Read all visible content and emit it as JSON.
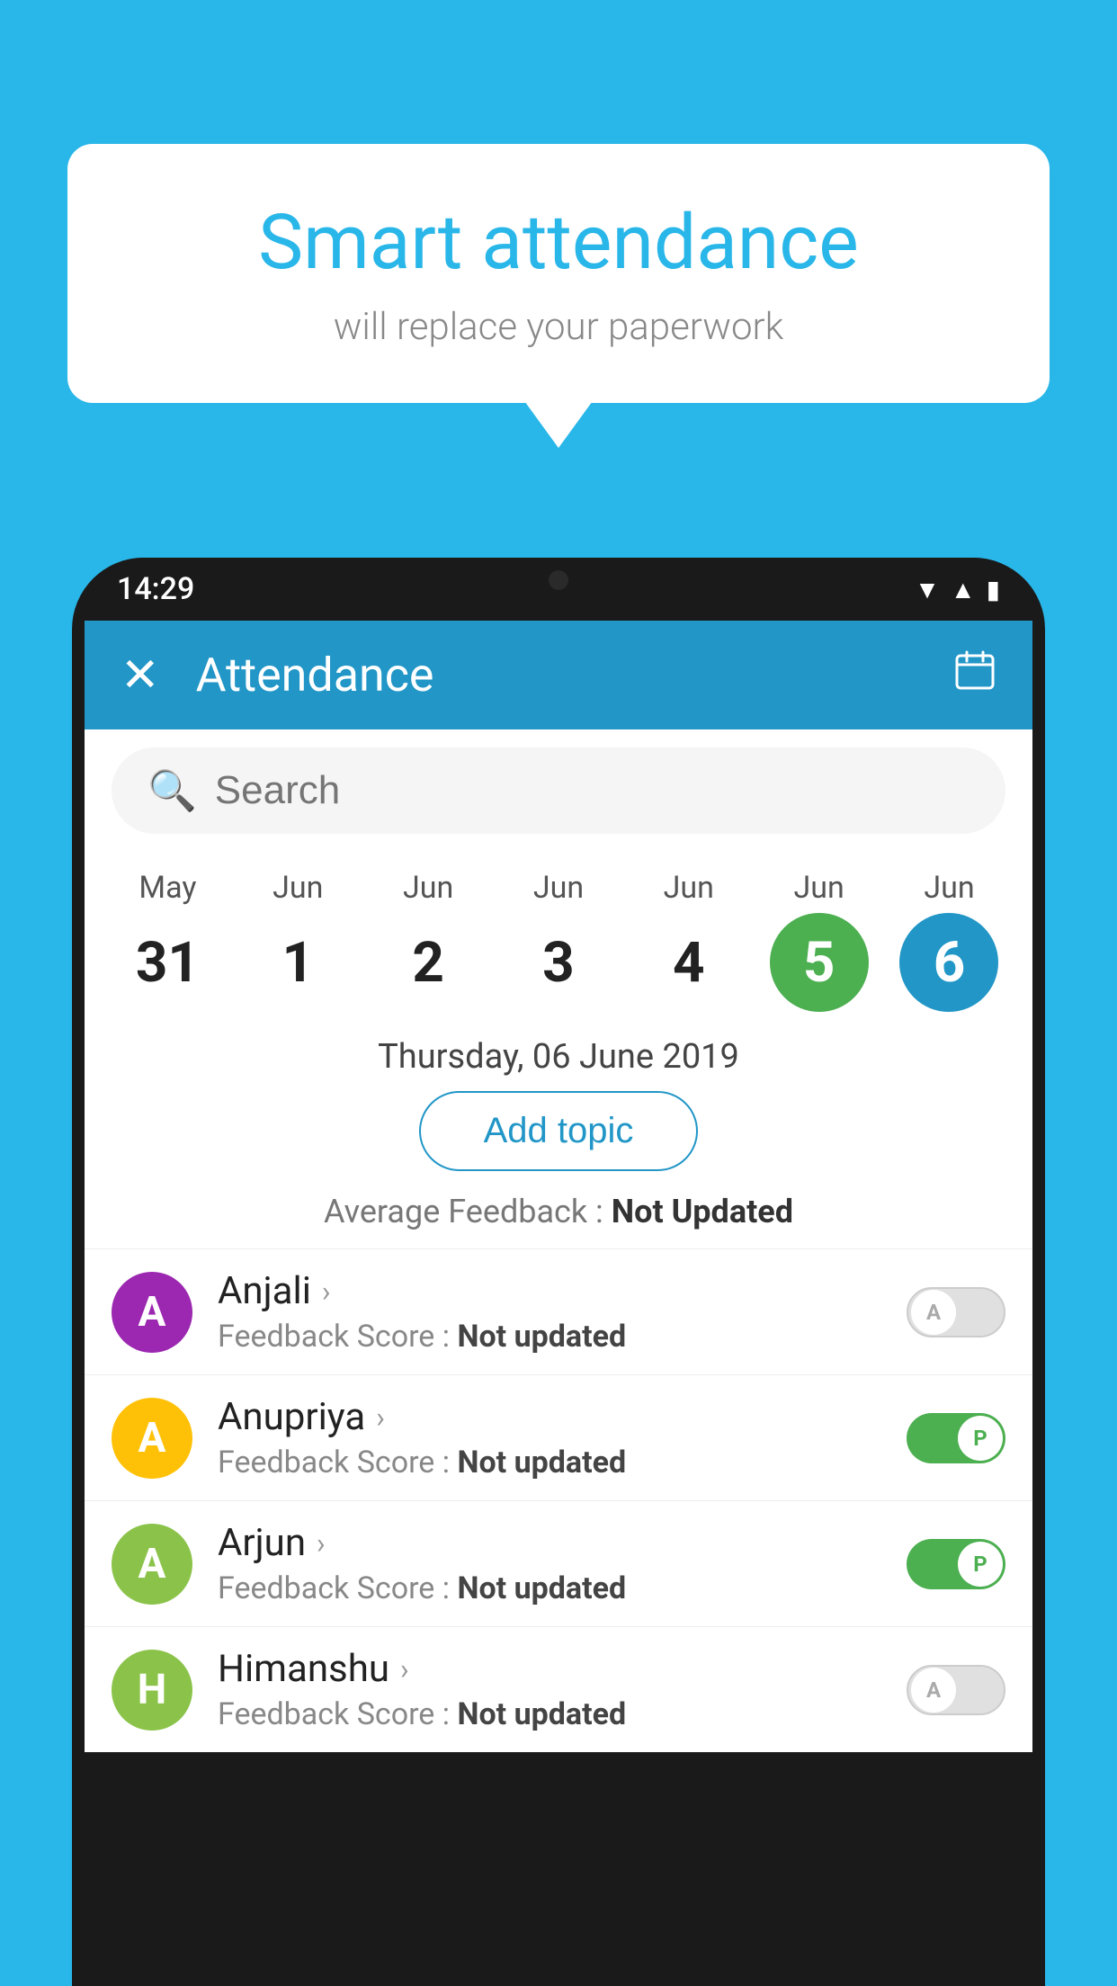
{
  "background_color": "#29b6e8",
  "speech_bubble": {
    "title": "Smart attendance",
    "subtitle": "will replace your paperwork"
  },
  "phone": {
    "status_bar": {
      "time": "14:29",
      "icons": [
        "wifi",
        "signal",
        "battery"
      ]
    },
    "header": {
      "close_label": "✕",
      "title": "Attendance",
      "calendar_icon": "📅"
    },
    "search": {
      "placeholder": "Search"
    },
    "dates": [
      {
        "month": "May",
        "day": "31",
        "highlight": "none"
      },
      {
        "month": "Jun",
        "day": "1",
        "highlight": "none"
      },
      {
        "month": "Jun",
        "day": "2",
        "highlight": "none"
      },
      {
        "month": "Jun",
        "day": "3",
        "highlight": "none"
      },
      {
        "month": "Jun",
        "day": "4",
        "highlight": "none"
      },
      {
        "month": "Jun",
        "day": "5",
        "highlight": "green"
      },
      {
        "month": "Jun",
        "day": "6",
        "highlight": "blue"
      }
    ],
    "selected_date_label": "Thursday, 06 June 2019",
    "add_topic_label": "Add topic",
    "avg_feedback_label": "Average Feedback :",
    "avg_feedback_value": "Not Updated",
    "students": [
      {
        "name": "Anjali",
        "avatar_letter": "A",
        "avatar_color": "#9c27b0",
        "feedback_label": "Feedback Score :",
        "feedback_value": "Not updated",
        "attendance_state": "off",
        "attendance_label": "A"
      },
      {
        "name": "Anupriya",
        "avatar_letter": "A",
        "avatar_color": "#ffc107",
        "feedback_label": "Feedback Score :",
        "feedback_value": "Not updated",
        "attendance_state": "on",
        "attendance_label": "P"
      },
      {
        "name": "Arjun",
        "avatar_letter": "A",
        "avatar_color": "#8bc34a",
        "feedback_label": "Feedback Score :",
        "feedback_value": "Not updated",
        "attendance_state": "on",
        "attendance_label": "P"
      },
      {
        "name": "Himanshu",
        "avatar_letter": "H",
        "avatar_color": "#8bc34a",
        "feedback_label": "Feedback Score :",
        "feedback_value": "Not updated",
        "attendance_state": "off",
        "attendance_label": "A"
      }
    ]
  }
}
